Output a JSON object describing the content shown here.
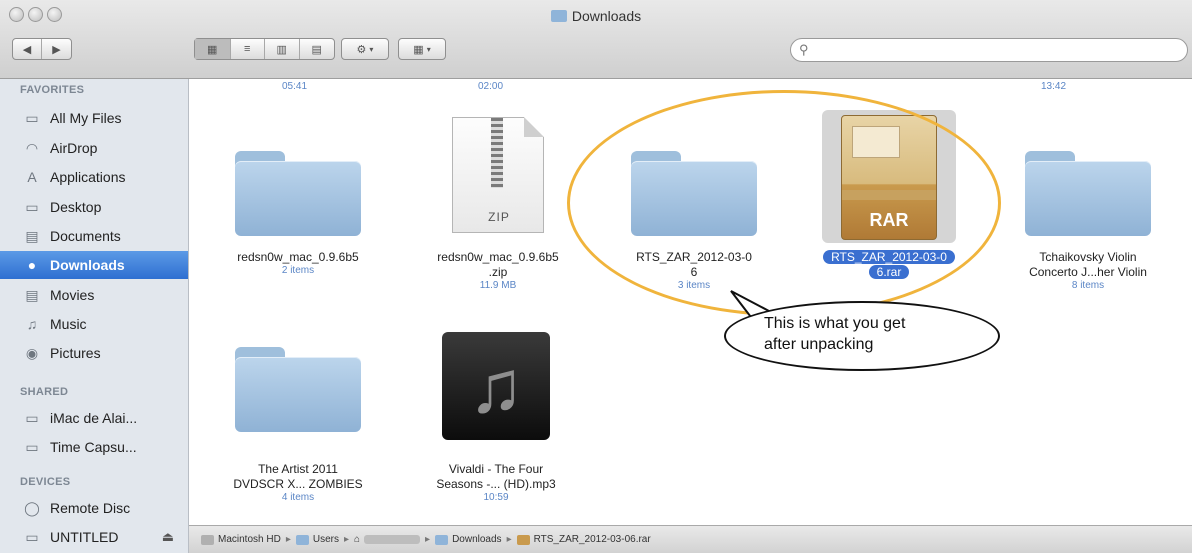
{
  "window": {
    "title": "Downloads"
  },
  "toolbar": {
    "back": "◀",
    "forward": "▶",
    "action": "⚙",
    "arrange": "▦",
    "search_placeholder": ""
  },
  "sidebar": {
    "favorites_header": "FAVORITES",
    "favorites": [
      {
        "label": "All My Files",
        "icon": "all-files-icon",
        "glyph": "▭"
      },
      {
        "label": "AirDrop",
        "icon": "airdrop-icon",
        "glyph": "◠"
      },
      {
        "label": "Applications",
        "icon": "applications-icon",
        "glyph": "A"
      },
      {
        "label": "Desktop",
        "icon": "desktop-icon",
        "glyph": "▭"
      },
      {
        "label": "Documents",
        "icon": "documents-icon",
        "glyph": "▤"
      },
      {
        "label": "Downloads",
        "icon": "downloads-icon",
        "glyph": "●"
      },
      {
        "label": "Movies",
        "icon": "movies-icon",
        "glyph": "▤"
      },
      {
        "label": "Music",
        "icon": "music-icon",
        "glyph": "♫"
      },
      {
        "label": "Pictures",
        "icon": "pictures-icon",
        "glyph": "◉"
      }
    ],
    "shared_header": "SHARED",
    "shared": [
      {
        "label": "iMac de Alai...",
        "icon": "imac-icon",
        "glyph": "▭"
      },
      {
        "label": "Time Capsu...",
        "icon": "time-capsule-icon",
        "glyph": "▭"
      }
    ],
    "devices_header": "DEVICES",
    "devices": [
      {
        "label": "Remote Disc",
        "icon": "remote-disc-icon",
        "glyph": "◯"
      },
      {
        "label": "UNTITLED",
        "icon": "drive-icon",
        "glyph": "▭",
        "eject": "⏏"
      }
    ]
  },
  "top_row_times": [
    "05:41",
    "02:00",
    "13:42"
  ],
  "files": [
    {
      "name_line1": "redsn0w_mac_0.9.6b5",
      "name_line2": "",
      "detail": "2 items",
      "kind": "folder"
    },
    {
      "name_line1": "redsn0w_mac_0.9.6b5",
      "name_line2": ".zip",
      "detail": "11.9 MB",
      "kind": "zip",
      "badge": "ZIP"
    },
    {
      "name_line1": "RTS_ZAR_2012-03-0",
      "name_line2": "6",
      "detail": "3 items",
      "kind": "folder"
    },
    {
      "name_line1": "RTS_ZAR_2012-03-0",
      "name_line2": "6.rar",
      "detail": "",
      "kind": "rar",
      "badge": "RAR"
    },
    {
      "name_line1": "Tchaikovsky Violin",
      "name_line2": "Concerto J...her Violin",
      "detail": "8 items",
      "kind": "folder"
    },
    {
      "name_line1": "The Artist 2011",
      "name_line2": "DVDSCR X... ZOMBIES",
      "detail": "4 items",
      "kind": "folder"
    },
    {
      "name_line1": "Vivaldi - The Four",
      "name_line2": "Seasons -... (HD).mp3",
      "detail": "10:59",
      "kind": "mp3"
    }
  ],
  "annotation": {
    "line1": "This is what you get",
    "line2": "after unpacking"
  },
  "pathbar": [
    {
      "label": "Macintosh HD",
      "icon": "hard-drive-icon"
    },
    {
      "label": "Users",
      "icon": "folder-icon"
    },
    {
      "label": "",
      "icon": "home-icon"
    },
    {
      "label": "Downloads",
      "icon": "folder-icon"
    },
    {
      "label": "RTS_ZAR_2012-03-06.rar",
      "icon": "rar-file-icon"
    }
  ],
  "colors": {
    "accent": "#2e6fd1",
    "highlight_ellipse": "#f0b43c",
    "sidebar_bg": "#e2e7ed"
  }
}
